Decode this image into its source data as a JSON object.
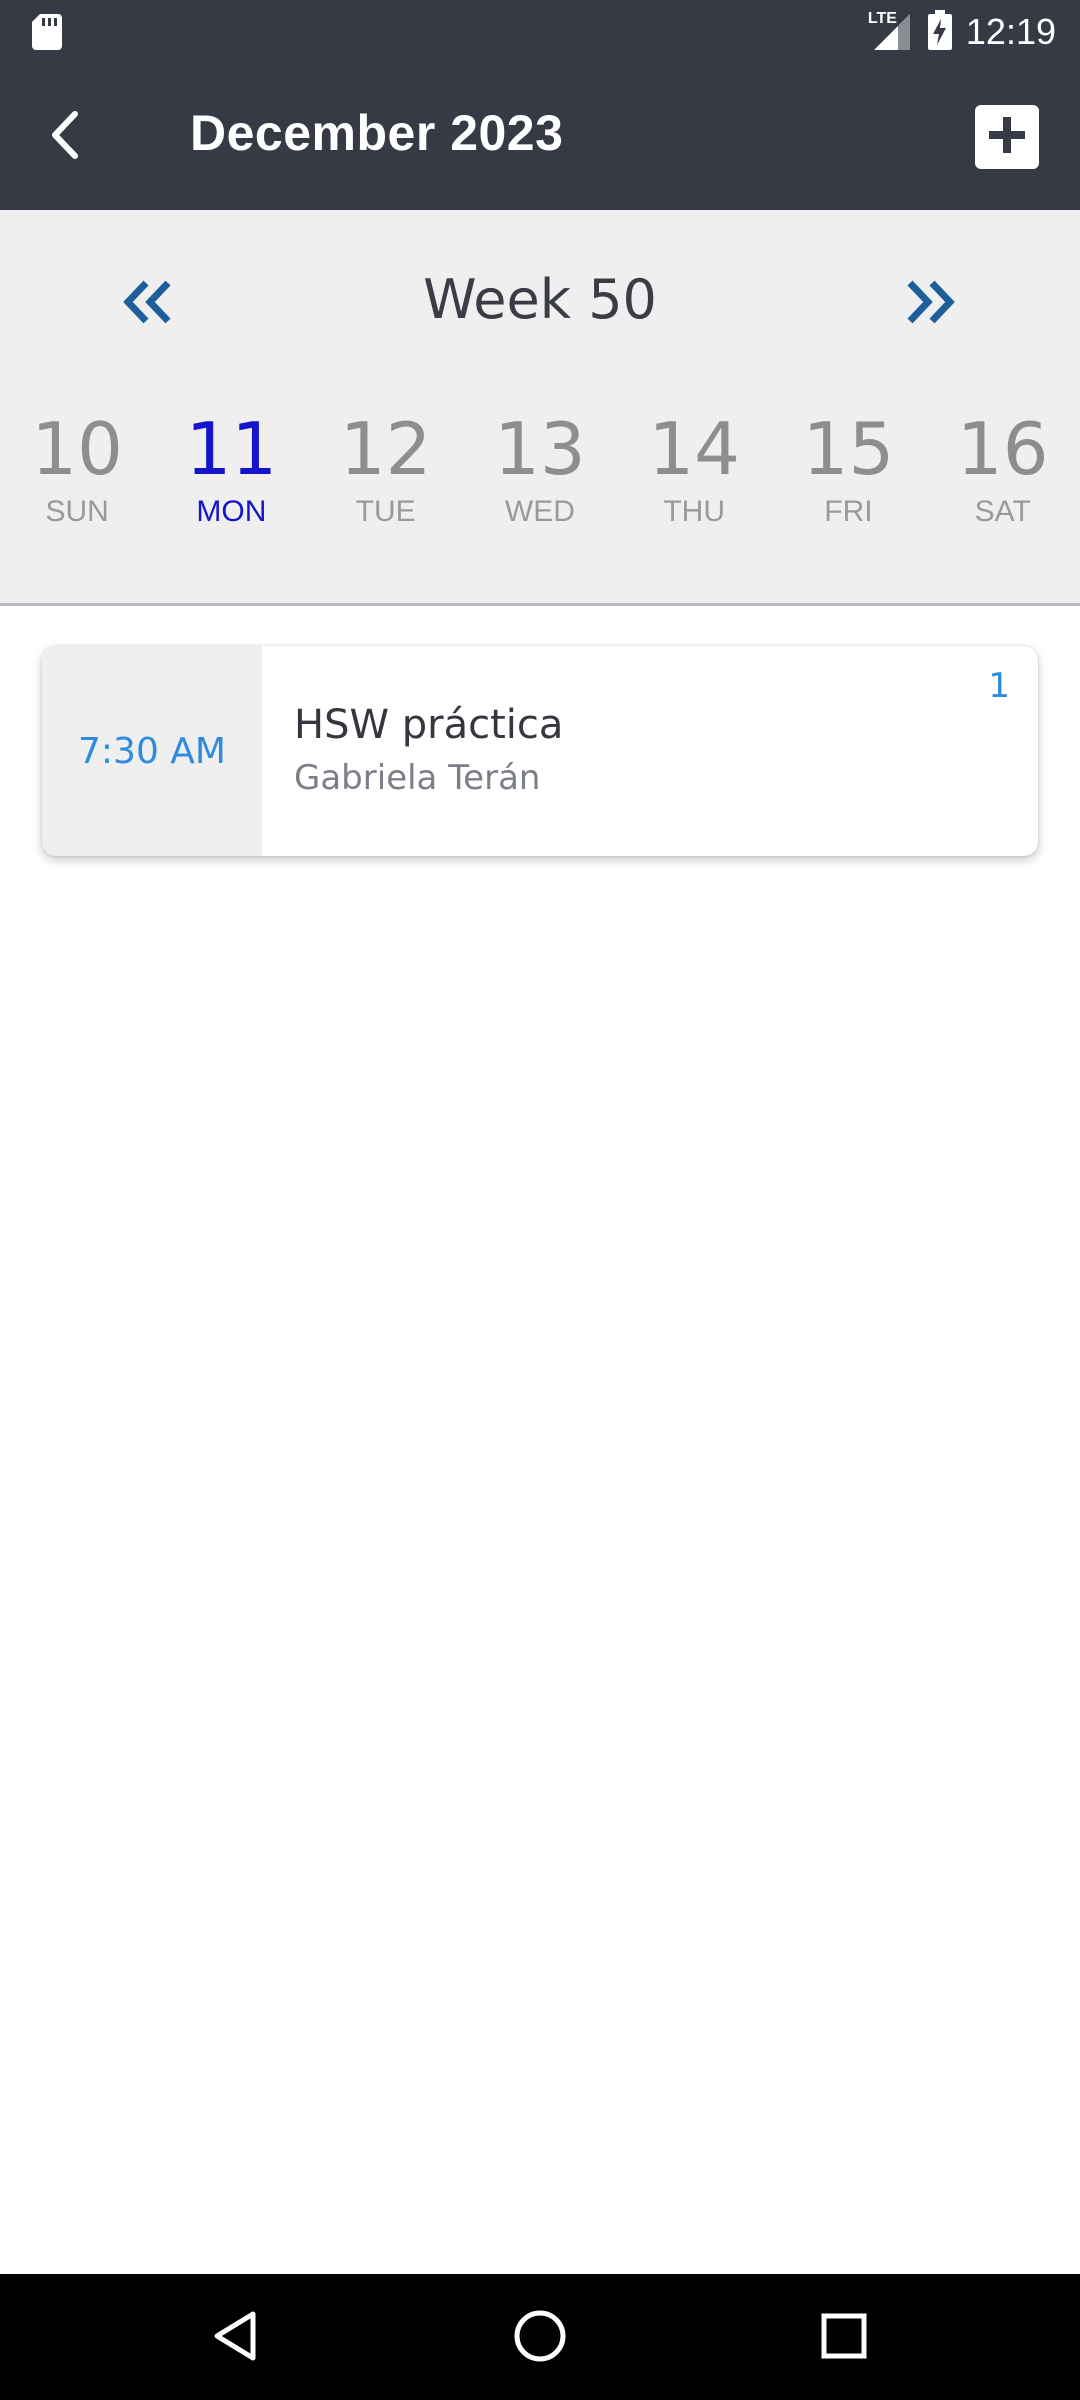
{
  "status_bar": {
    "time": "12:19",
    "network": "LTE",
    "icons": [
      "sd-card-icon",
      "signal-icon",
      "battery-charging-icon"
    ]
  },
  "app_bar": {
    "title": "December 2023",
    "back_icon": "chevron-left-icon",
    "add_icon": "plus-icon"
  },
  "week_nav": {
    "label": "Week 50",
    "prev_icon": "double-chevron-left-icon",
    "next_icon": "double-chevron-right-icon"
  },
  "days": [
    {
      "num": "10",
      "name": "SUN"
    },
    {
      "num": "11",
      "name": "MON"
    },
    {
      "num": "12",
      "name": "TUE"
    },
    {
      "num": "13",
      "name": "WED"
    },
    {
      "num": "14",
      "name": "THU"
    },
    {
      "num": "15",
      "name": "FRI"
    },
    {
      "num": "16",
      "name": "SAT"
    }
  ],
  "selected_day": "MON",
  "events": [
    {
      "time": "7:30 AM",
      "title": "HSW práctica",
      "subtitle": "Gabriela Terán",
      "count": "1"
    }
  ],
  "colors": {
    "header_bg": "#363a45",
    "panel_bg": "#efefef",
    "selected_day": "#1414cc",
    "accent_blue": "#2e8be0",
    "chevron_blue": "#1d5f9a"
  },
  "nav_bar": {
    "icons": [
      "back-triangle-icon",
      "home-circle-icon",
      "recents-square-icon"
    ]
  }
}
